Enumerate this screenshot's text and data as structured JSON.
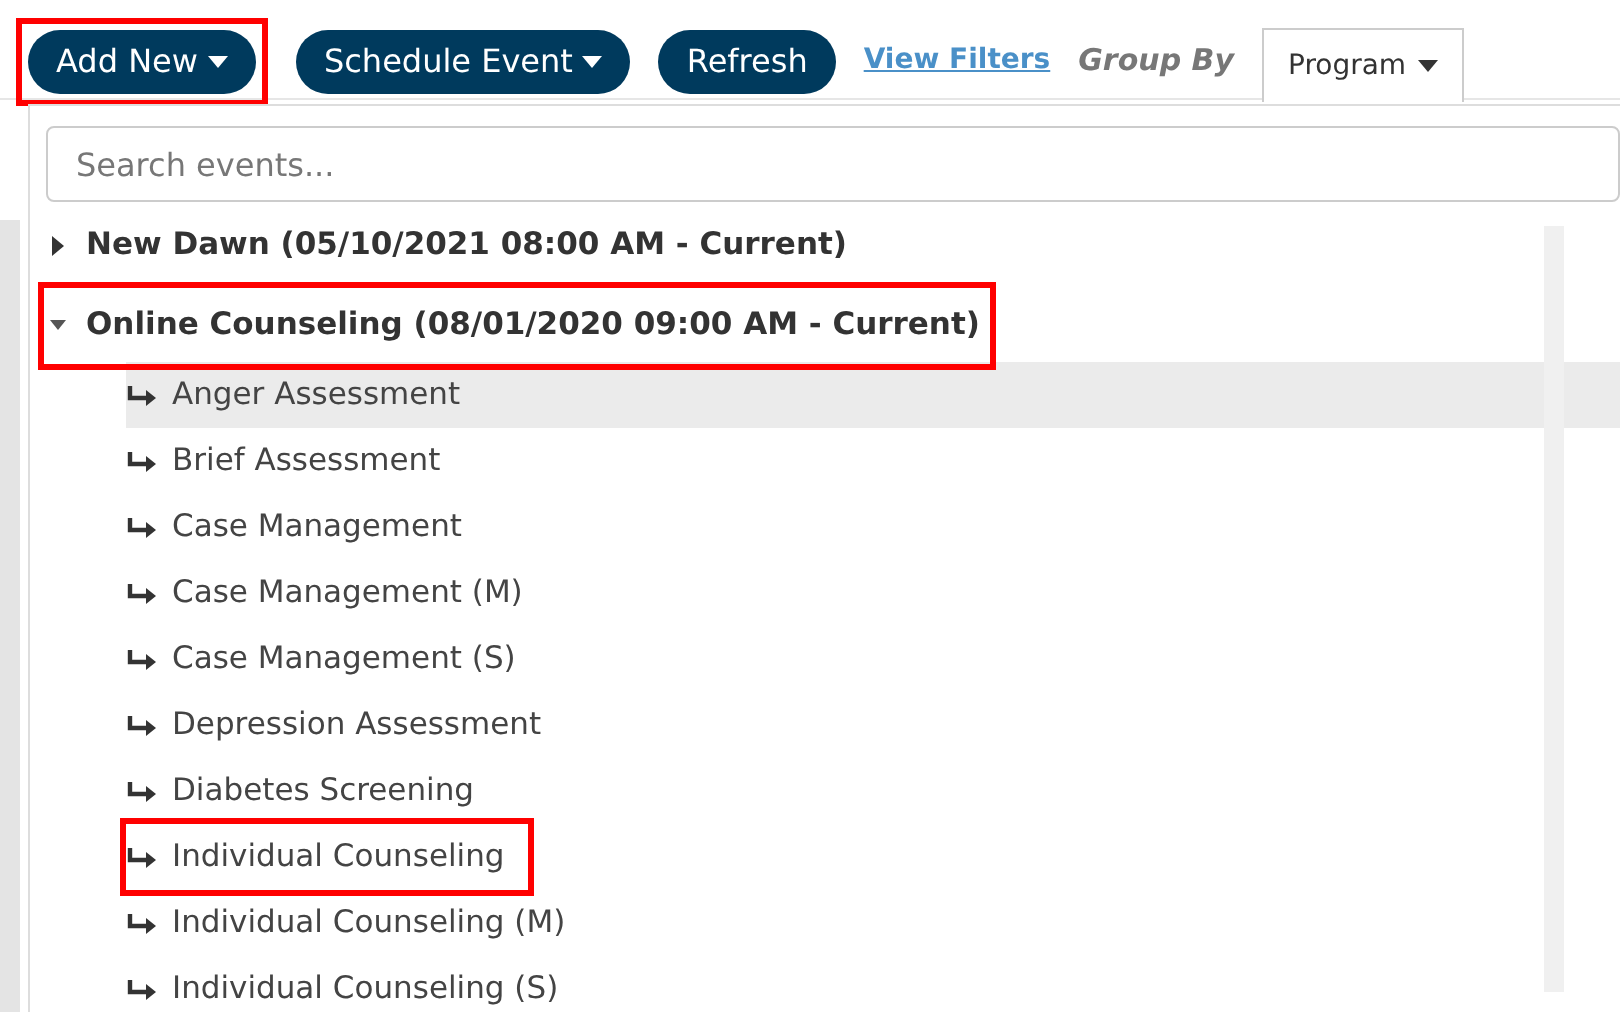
{
  "toolbar": {
    "buttons": [
      {
        "label": "Add New",
        "caret": true,
        "highlighted": true
      },
      {
        "label": "Schedule Event",
        "caret": true,
        "highlighted": false
      },
      {
        "label": "Refresh",
        "caret": false,
        "highlighted": false
      }
    ],
    "link": "View Filters",
    "group_by_label": "Group By",
    "group_by_value": "Program"
  },
  "search": {
    "placeholder": "Search events..."
  },
  "tree": [
    {
      "label": "New Dawn (05/10/2021 08:00 AM - Current)",
      "expanded": false,
      "highlighted": false
    },
    {
      "label": "Online Counseling (08/01/2020 09:00 AM - Current)",
      "expanded": true,
      "highlighted": true,
      "children": [
        {
          "label": "Anger Assessment",
          "selected": true,
          "highlighted": false
        },
        {
          "label": "Brief Assessment",
          "selected": false,
          "highlighted": false
        },
        {
          "label": "Case Management",
          "selected": false,
          "highlighted": false
        },
        {
          "label": "Case Management (M)",
          "selected": false,
          "highlighted": false
        },
        {
          "label": "Case Management (S)",
          "selected": false,
          "highlighted": false
        },
        {
          "label": "Depression Assessment",
          "selected": false,
          "highlighted": false
        },
        {
          "label": "Diabetes Screening",
          "selected": false,
          "highlighted": false
        },
        {
          "label": "Individual Counseling",
          "selected": false,
          "highlighted": true
        },
        {
          "label": "Individual Counseling (M)",
          "selected": false,
          "highlighted": false
        },
        {
          "label": "Individual Counseling (S)",
          "selected": false,
          "highlighted": false
        }
      ]
    }
  ]
}
